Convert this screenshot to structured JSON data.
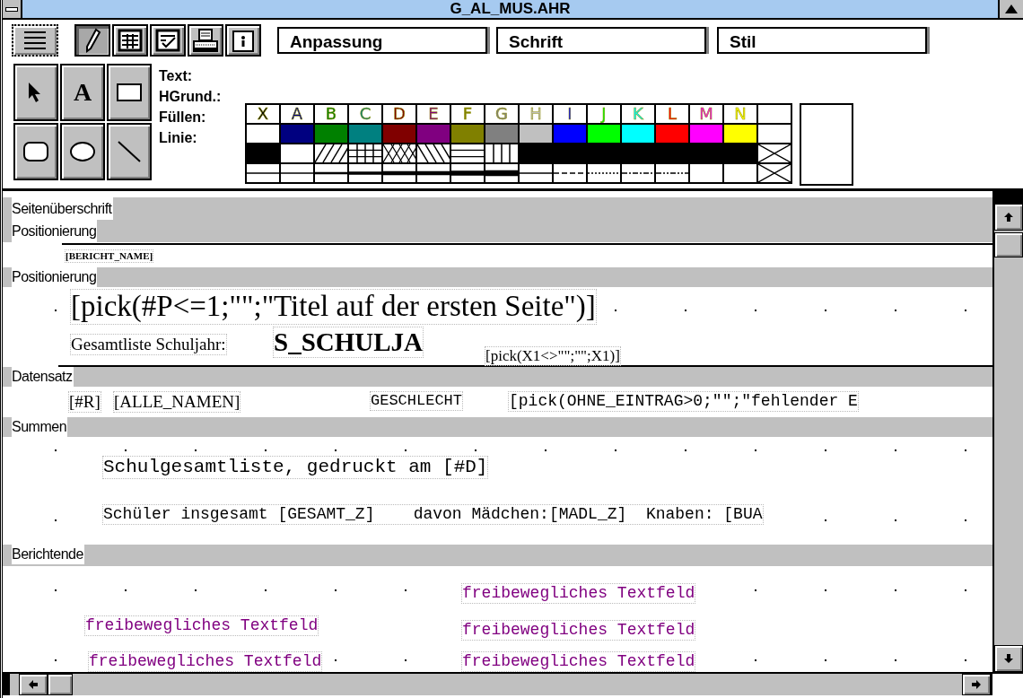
{
  "window": {
    "title": "G_AL_MUS.AHR"
  },
  "toolbar": {
    "buttons": [
      {
        "kind": "lines",
        "selected": false
      },
      {
        "kind": "pencil",
        "selected": true
      },
      {
        "kind": "table",
        "selected": false
      },
      {
        "kind": "checklist",
        "selected": false
      },
      {
        "kind": "printer",
        "selected": false
      },
      {
        "kind": "info",
        "selected": false
      }
    ],
    "fields": [
      {
        "value": "Anpassung"
      },
      {
        "value": "Schrift"
      },
      {
        "value": "Stil"
      }
    ]
  },
  "drawing_tools": [
    {
      "kind": "pointer"
    },
    {
      "kind": "text",
      "label": "A"
    },
    {
      "kind": "rectangle"
    },
    {
      "kind": "rounded-rectangle"
    },
    {
      "kind": "ellipse"
    },
    {
      "kind": "line"
    }
  ],
  "palette": {
    "row_labels": [
      "Text:",
      "HGrund.:",
      "Füllen:",
      "Linie:"
    ],
    "columns": [
      {
        "kind": "none",
        "letter": "X"
      },
      {
        "kind": "color",
        "letter": "A",
        "color": "#000080"
      },
      {
        "kind": "color",
        "letter": "B",
        "color": "#008000"
      },
      {
        "kind": "color",
        "letter": "C",
        "color": "#008080"
      },
      {
        "kind": "color",
        "letter": "D",
        "color": "#800000"
      },
      {
        "kind": "color",
        "letter": "E",
        "color": "#800080"
      },
      {
        "kind": "color",
        "letter": "F",
        "color": "#808000"
      },
      {
        "kind": "color",
        "letter": "G",
        "color": "#808080"
      },
      {
        "kind": "color",
        "letter": "H",
        "color": "#c0c0c0"
      },
      {
        "kind": "color",
        "letter": "I",
        "color": "#0000ff"
      },
      {
        "kind": "color",
        "letter": "J",
        "color": "#00ff00"
      },
      {
        "kind": "color",
        "letter": "K",
        "color": "#00ffff"
      },
      {
        "kind": "color",
        "letter": "L",
        "color": "#ff0000"
      },
      {
        "kind": "color",
        "letter": "M",
        "color": "#ff00ff"
      },
      {
        "kind": "color",
        "letter": "N",
        "color": "#ffff00"
      },
      {
        "kind": "blank"
      }
    ]
  },
  "canvas": {
    "bands": [
      {
        "labels": [
          "Seitenüberschrift",
          "Positionierung"
        ]
      },
      {
        "labels": [
          "Positionierung"
        ]
      },
      {
        "labels": [
          "Datensatz"
        ]
      },
      {
        "labels": [
          "Summen"
        ]
      },
      {
        "labels": [
          "Berichtende"
        ]
      }
    ],
    "fields": [
      {
        "kind": "small-bold",
        "text": "[BERICHT_NAME]"
      },
      {
        "kind": "title",
        "text": "[pick(#P<=1;\"\";\"Titel auf der ersten Seite\")]"
      },
      {
        "kind": "serif",
        "text": "Gesamtliste Schuljahr:"
      },
      {
        "kind": "heading",
        "text": "S_SCHULJA"
      },
      {
        "kind": "serif-small",
        "text": "[pick(X1<>\"\";\"\";X1)]"
      },
      {
        "kind": "serif",
        "text": "[#R]"
      },
      {
        "kind": "serif",
        "text": "[ALLE_NAMEN]"
      },
      {
        "kind": "mono-small",
        "text": "GESCHLECHT"
      },
      {
        "kind": "mono",
        "text": "[pick(OHNE_EINTRAG>0;\"\";\"fehlender E"
      },
      {
        "kind": "mono-large",
        "text": "Schulgesamtliste, gedruckt am [#D]"
      },
      {
        "kind": "mono",
        "text": "Schüler insgesamt [GESAMT_Z]    davon Mädchen:[MADL_Z]  Knaben: [BUA"
      },
      {
        "kind": "mono-purple",
        "text": "freibewegliches Textfeld"
      },
      {
        "kind": "mono-purple",
        "text": "freibewegliches Textfeld"
      },
      {
        "kind": "mono-purple",
        "text": "freibewegliches Textfeld"
      },
      {
        "kind": "mono-purple",
        "text": "freibewegliches Textfeld"
      },
      {
        "kind": "mono-purple",
        "text": "freibewegliches Textfeld"
      }
    ]
  }
}
